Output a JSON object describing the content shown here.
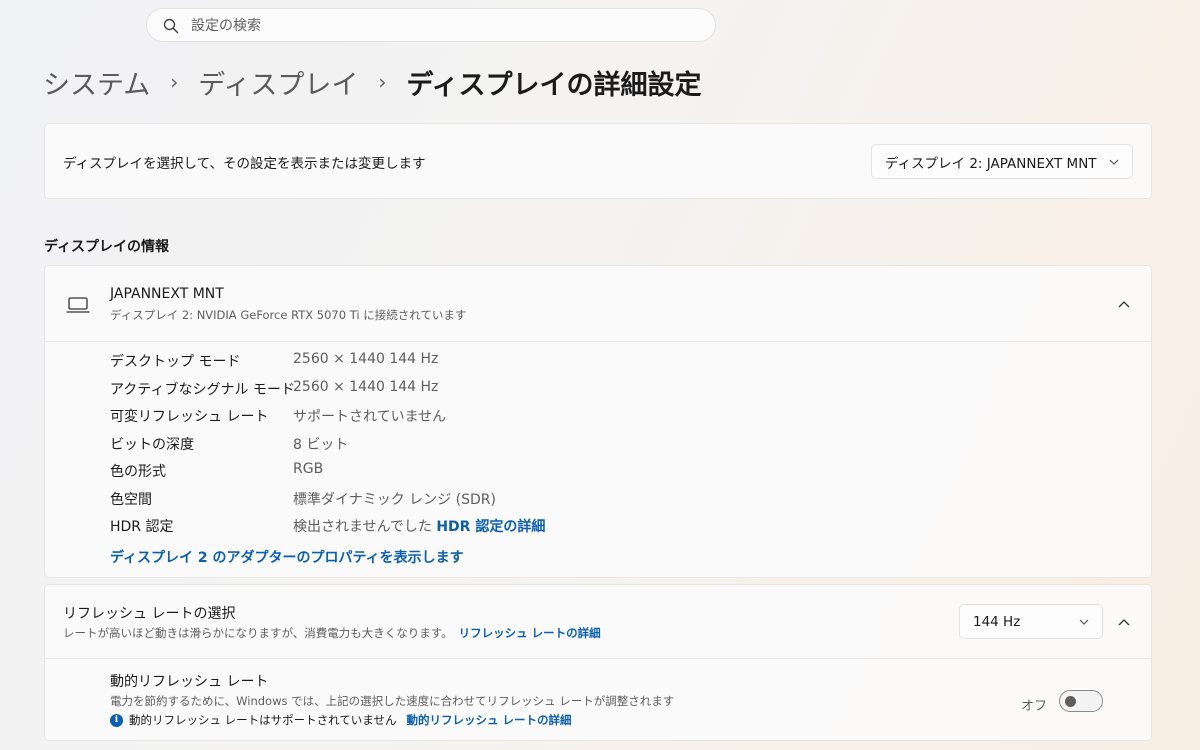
{
  "search": {
    "placeholder": "設定の検索"
  },
  "breadcrumb": {
    "items": [
      "システム",
      "ディスプレイ",
      "ディスプレイの詳細設定"
    ],
    "separator": "›"
  },
  "display_select": {
    "label": "ディスプレイを選択して、その設定を表示または変更します",
    "value": "ディスプレイ 2: JAPANNEXT MNT"
  },
  "display_info": {
    "section_title": "ディスプレイの情報",
    "name": "JAPANNEXT MNT",
    "subtitle": "ディスプレイ 2: NVIDIA GeForce RTX 5070 Ti に接続されています",
    "icon": "monitor-icon",
    "properties": [
      {
        "key": "デスクトップ モード",
        "value": "2560 × 1440 144 Hz"
      },
      {
        "key": "アクティブなシグナル モード",
        "value": "2560 × 1440 144 Hz"
      },
      {
        "key": "可変リフレッシュ レート",
        "value": "サポートされていません"
      },
      {
        "key": "ビットの深度",
        "value": "8 ビット"
      },
      {
        "key": "色の形式",
        "value": "RGB"
      },
      {
        "key": "色空間",
        "value": "標準ダイナミック レンジ (SDR)"
      },
      {
        "key": "HDR 認定",
        "value": "検出されませんでした"
      }
    ],
    "hdr_link": "HDR 認定の詳細",
    "adapter_link": "ディスプレイ 2 のアダプターのプロパティを表示します"
  },
  "refresh_rate": {
    "title": "リフレッシュ レートの選択",
    "description": "レートが高いほど動きは滑らかになりますが、消費電力も大きくなります。",
    "link": "リフレッシュ レートの詳細",
    "value": "144 Hz"
  },
  "dynamic_refresh": {
    "title": "動的リフレッシュ レート",
    "description": "電力を節約するために、Windows では、上記の選択した速度に合わせてリフレッシュ レートが調整されます",
    "note": "動的リフレッシュ レートはサポートされていません",
    "link": "動的リフレッシュ レートの詳細",
    "toggle_label": "オフ",
    "toggle_on": false
  },
  "colors": {
    "accent": "#0a5fb3"
  }
}
